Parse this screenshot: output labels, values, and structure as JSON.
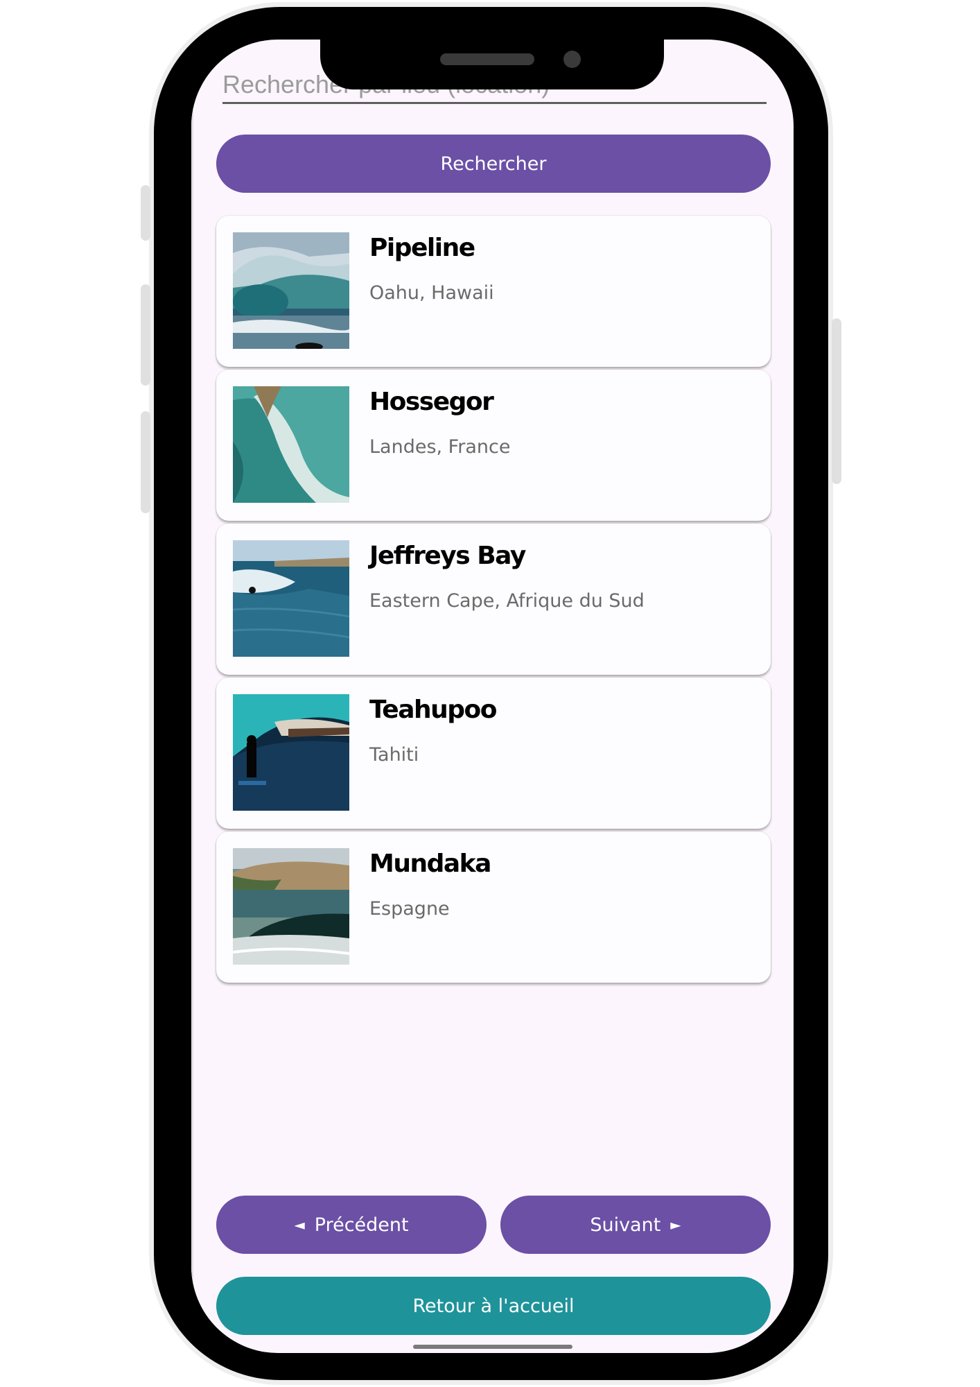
{
  "search": {
    "placeholder": "Rechercher par lieu (location)",
    "button_label": "Rechercher"
  },
  "spots": [
    {
      "name": "Pipeline",
      "location": "Oahu, Hawaii"
    },
    {
      "name": "Hossegor",
      "location": "Landes, France"
    },
    {
      "name": "Jeffreys Bay",
      "location": "Eastern Cape, Afrique du Sud"
    },
    {
      "name": "Teahupoo",
      "location": "Tahiti"
    },
    {
      "name": "Mundaka",
      "location": "Espagne"
    }
  ],
  "pagination": {
    "prev_label": "Précédent",
    "next_label": "Suivant",
    "prev_icon": "◄",
    "next_icon": "►"
  },
  "home_button_label": "Retour à l'accueil",
  "colors": {
    "primary": "#6b50a5",
    "secondary": "#1e939a",
    "background": "#fcf5fd"
  }
}
